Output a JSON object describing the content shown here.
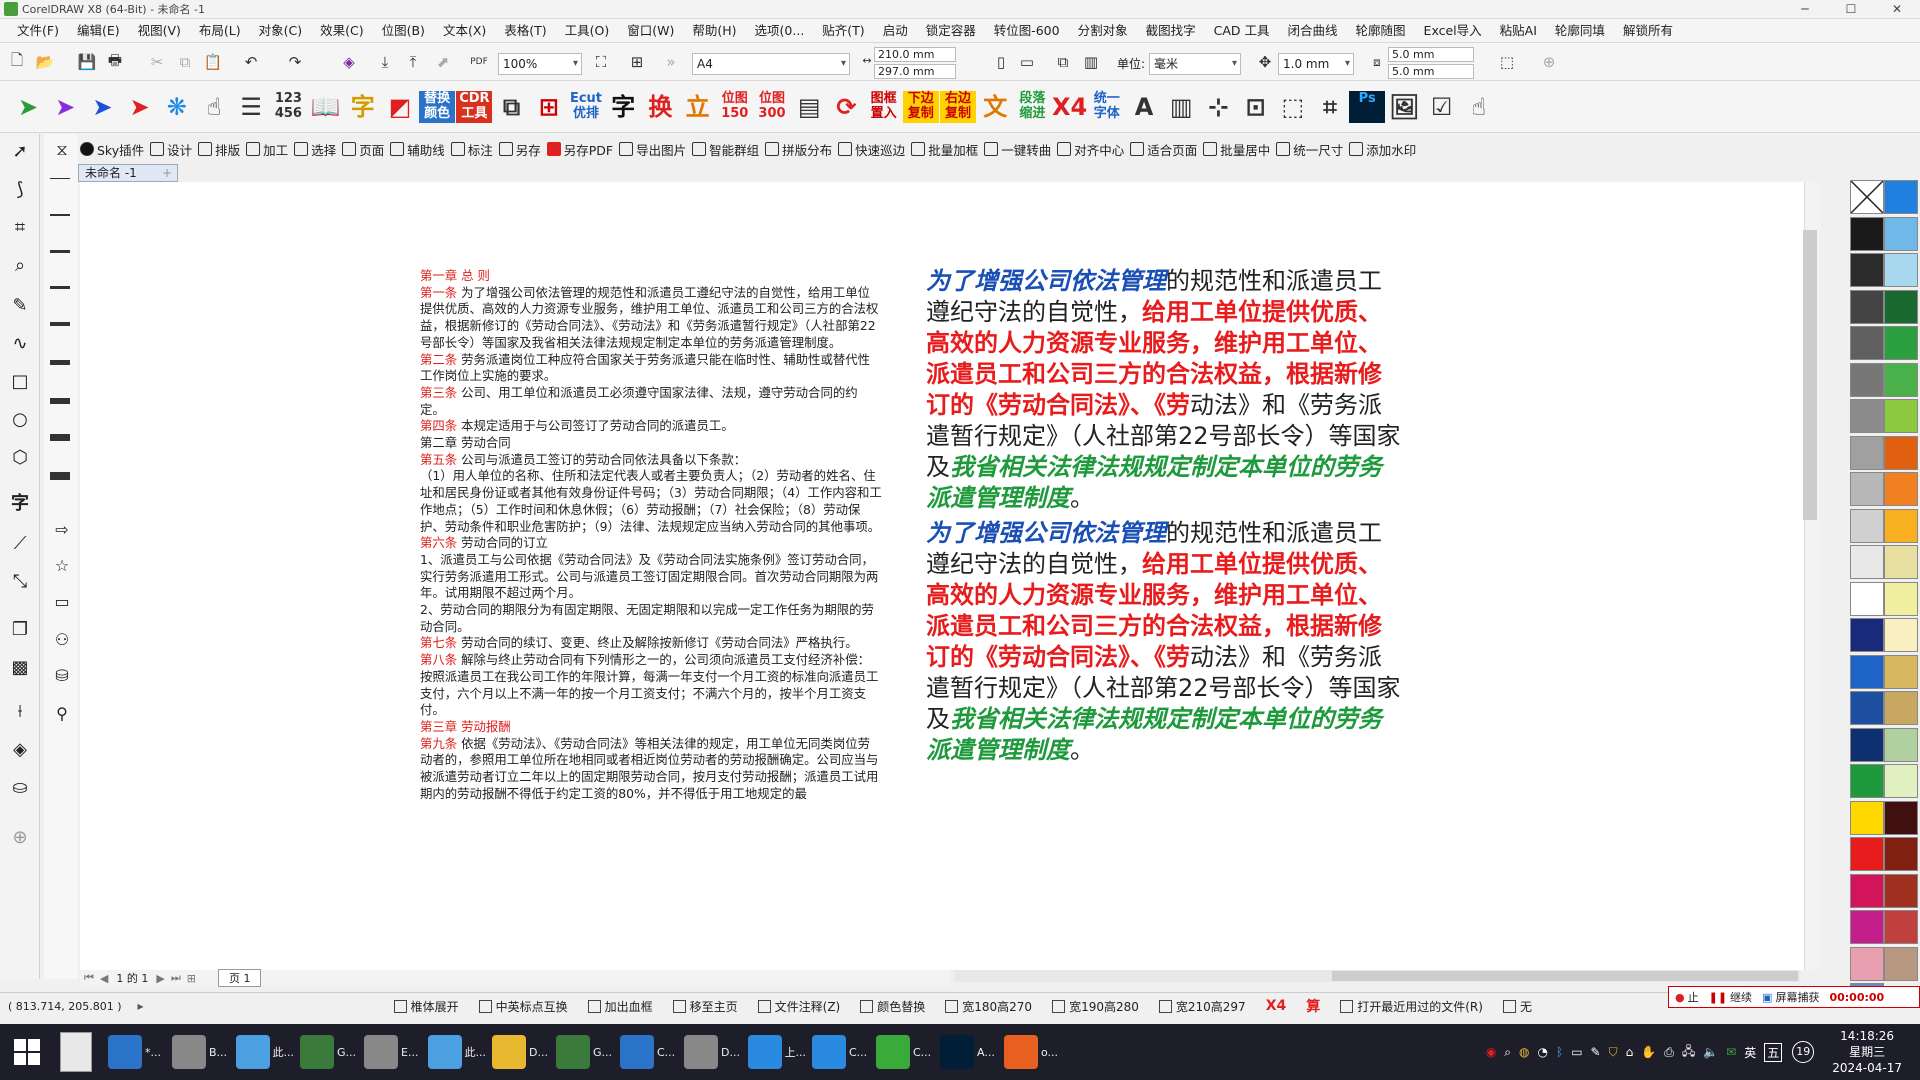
{
  "window": {
    "title": "CorelDRAW X8 (64-Bit) - 未命名 -1",
    "controls": [
      "─",
      "☐",
      "✕"
    ]
  },
  "menu": [
    "文件(F)",
    "编辑(E)",
    "视图(V)",
    "布局(L)",
    "对象(C)",
    "效果(C)",
    "位图(B)",
    "文本(X)",
    "表格(T)",
    "工具(O)",
    "窗口(W)",
    "帮助(H)",
    "选项(0...",
    "贴齐(T)",
    "启动",
    "锁定容器",
    "转位图-600",
    "分割对象",
    "截图找字",
    "CAD 工具",
    "闭合曲线",
    "轮廓随图",
    "Excel导入",
    "粘贴AI",
    "轮廓同填",
    "解锁所有"
  ],
  "std_toolbar": {
    "zoom": "100%",
    "paper": "A4",
    "width": "210.0 mm",
    "height": "297.0 mm",
    "units_label": "单位:",
    "units": "毫米",
    "nudge": "1.0 mm",
    "dup_x": "5.0 mm",
    "dup_y": "5.0 mm"
  },
  "big_icons": [
    {
      "kind": "glyph",
      "text": "➤",
      "color": "#2c9a3b"
    },
    {
      "kind": "glyph",
      "text": "➤",
      "color": "#8a2be2"
    },
    {
      "kind": "glyph",
      "text": "➤",
      "color": "#1e4fd8"
    },
    {
      "kind": "glyph",
      "text": "➤",
      "color": "#e02020"
    },
    {
      "kind": "glyph",
      "text": "❋",
      "color": "#1e88e5"
    },
    {
      "kind": "glyph",
      "text": "☝",
      "color": "#333"
    },
    {
      "kind": "glyph",
      "text": "☰",
      "color": "#333"
    },
    {
      "kind": "text",
      "text": "123 456",
      "color": "#333"
    },
    {
      "kind": "glyph",
      "text": "📖",
      "color": "#333"
    },
    {
      "kind": "glyph",
      "text": "字",
      "color": "#d49a00"
    },
    {
      "kind": "glyph",
      "text": "◩",
      "color": "#e02020"
    },
    {
      "kind": "text",
      "text": "替换 颜色",
      "color": "#fff",
      "bg": "#2a73c9"
    },
    {
      "kind": "text",
      "text": "CDR 工具",
      "color": "#fff",
      "bg": "#d8321e"
    },
    {
      "kind": "glyph",
      "text": "⧉",
      "color": "#333"
    },
    {
      "kind": "glyph",
      "text": "⊞",
      "color": "#c00"
    },
    {
      "kind": "text",
      "text": "Ecut 优排",
      "color": "#1e64c8"
    },
    {
      "kind": "glyph",
      "text": "字",
      "color": "#111"
    },
    {
      "kind": "glyph",
      "text": "换",
      "color": "#e02020"
    },
    {
      "kind": "glyph",
      "text": "立",
      "color": "#e07800"
    },
    {
      "kind": "text",
      "text": "位图 150",
      "color": "#e02020"
    },
    {
      "kind": "text",
      "text": "位图 300",
      "color": "#e02020"
    },
    {
      "kind": "glyph",
      "text": "▤",
      "color": "#333"
    },
    {
      "kind": "glyph",
      "text": "⟳",
      "color": "#e02020"
    },
    {
      "kind": "text",
      "text": "图框 置入",
      "color": "#c00"
    },
    {
      "kind": "text",
      "text": "下边 复制",
      "color": "#c00",
      "bg": "#ffd200"
    },
    {
      "kind": "text",
      "text": "右边 复制",
      "color": "#c00",
      "bg": "#ffd200"
    },
    {
      "kind": "glyph",
      "text": "文",
      "color": "#e07800"
    },
    {
      "kind": "text",
      "text": "段落 缩进",
      "color": "#1e9a3c"
    },
    {
      "kind": "glyph",
      "text": "X4",
      "color": "#e02020"
    },
    {
      "kind": "text",
      "text": "统一 字体",
      "color": "#1e64c8"
    },
    {
      "kind": "glyph",
      "text": "A",
      "color": "#333"
    },
    {
      "kind": "glyph",
      "text": "▥",
      "color": "#333"
    },
    {
      "kind": "glyph",
      "text": "⊹",
      "color": "#333"
    },
    {
      "kind": "glyph",
      "text": "⊡",
      "color": "#333"
    },
    {
      "kind": "glyph",
      "text": "⬚",
      "color": "#333"
    },
    {
      "kind": "glyph",
      "text": "⌗",
      "color": "#333"
    },
    {
      "kind": "text",
      "text": "Ps",
      "color": "#31a8ff",
      "bg": "#001e36"
    },
    {
      "kind": "glyph",
      "text": "🖼",
      "color": "#333"
    },
    {
      "kind": "glyph",
      "text": "☑",
      "color": "#333"
    },
    {
      "kind": "glyph",
      "text": "☝",
      "color": "#333"
    }
  ],
  "plugin_bar": [
    "Sky插件",
    "设计",
    "排版",
    "加工",
    "选择",
    "页面",
    "辅助线",
    "标注",
    "另存",
    "另存PDF",
    "导出图片",
    "智能群组",
    "拼版分布",
    "快速巡边",
    "批量加框",
    "一键转曲",
    "对齐中心",
    "适合页面",
    "批量居中",
    "统一尺寸",
    "添加水印"
  ],
  "doc_tab": "未命名 -1",
  "left_doc": [
    [
      {
        "t": "第一章  总 则",
        "r": true
      }
    ],
    [
      {
        "t": "第一条",
        "r": true
      },
      {
        "t": " 为了增强公司依法管理的规范性和派遣员工遵纪守法的自觉性，给用工单位提供优质、高效的人力资源专业服务，维护用工单位、派遣员工和公司三方的合法权益，根据新修订的《劳动合同法》、《劳动法》和《劳务派遣暂行规定》（人社部第22号部长令）等国家及我省相关法律法规规定制定本单位的劳务派遣管理制度。"
      }
    ],
    [
      {
        "t": "第二条",
        "r": true
      },
      {
        "t": " 劳务派遣岗位工种应符合国家关于劳务派遣只能在临时性、辅助性或替代性工作岗位上实施的要求。"
      }
    ],
    [
      {
        "t": "第三条",
        "r": true
      },
      {
        "t": " 公司、用工单位和派遣员工必须遵守国家法律、法规，遵守劳动合同的约定。"
      }
    ],
    [
      {
        "t": "第四条",
        "r": true
      },
      {
        "t": " 本规定适用于与公司签订了劳动合同的派遣员工。"
      }
    ],
    [
      {
        "t": "第二章 劳动合同"
      }
    ],
    [
      {
        "t": "第五条",
        "r": true
      },
      {
        "t": " 公司与派遣员工签订的劳动合同依法具备以下条款："
      }
    ],
    [
      {
        "t": "（1）用人单位的名称、住所和法定代表人或者主要负责人；（2）劳动者的姓名、住址和居民身份证或者其他有效身份证件号码；（3）劳动合同期限；（4）工作内容和工作地点；（5）工作时间和休息休假；（6）劳动报酬；（7）社会保险；（8）劳动保护、劳动条件和职业危害防护；（9）法律、法规规定应当纳入劳动合同的其他事项。"
      }
    ],
    [
      {
        "t": "第六条",
        "r": true
      },
      {
        "t": " 劳动合同的订立"
      }
    ],
    [
      {
        "t": "1、派遣员工与公司依据《劳动合同法》及《劳动合同法实施条例》签订劳动合同，实行劳务派遣用工形式。公司与派遣员工签订固定期限合同。首次劳动合同期限为两年。试用期限不超过两个月。"
      }
    ],
    [
      {
        "t": "2、劳动合同的期限分为有固定期限、无固定期限和以完成一定工作任务为期限的劳动合同。"
      }
    ],
    [
      {
        "t": "第七条",
        "r": true
      },
      {
        "t": " 劳动合同的续订、变更、终止及解除按新修订《劳动合同法》严格执行。"
      }
    ],
    [
      {
        "t": "第八条",
        "r": true
      },
      {
        "t": " 解除与终止劳动合同有下列情形之一的，公司须向派遣员工支付经济补偿：按照派遣员工在我公司工作的年限计算，每满一年支付一个月工资的标准向派遣员工支付，六个月以上不满一年的按一个月工资支付；不满六个月的，按半个月工资支付。"
      }
    ],
    [
      {
        "t": "第三章  劳动报酬",
        "r": true
      }
    ],
    [
      {
        "t": "第九条",
        "r": true
      },
      {
        "t": " 依据《劳动法》、《劳动合同法》等相关法律的规定，用工单位无同类岗位劳动者的，参照用工单位所在地相同或者相近岗位劳动者的劳动报酬确定。公司应当与被派遣劳动者订立二年以上的固定期限劳动合同，按月支付劳动报酬；派遣员工试用期内的劳动报酬不得低于约定工资的80%，并不得低于用工地规定的最"
      }
    ]
  ],
  "right_doc": [
    [
      {
        "t": "为了增强公司依法管理",
        "c": "b"
      },
      {
        "t": "的规范性和派遣员工遵纪守法的自觉性，",
        "c": "n"
      },
      {
        "t": "给用工单位提供优质、高效的人力资源专业服务，维护用工单位、派遣员工和公司三方的合法权益，根据新修订的《劳动合同法》、《劳",
        "c": "r"
      },
      {
        "t": "动法》和《劳务派遣暂行规定》（人社部第22号部长令）等国家及",
        "c": "n"
      },
      {
        "t": "我省相关法律法规规定制定本单位的劳务派遣管理制度",
        "c": "g"
      },
      {
        "t": "。",
        "c": "n"
      }
    ],
    [
      {
        "t": "为了增强公司依法管理",
        "c": "b"
      },
      {
        "t": "的规范性和派遣员工遵纪守法的自觉性，",
        "c": "n"
      },
      {
        "t": "给用工单位提供优质、高效的人力资源专业服务，维护用工单位、派遣员工和公司三方的合法权益，根据新修订的《劳动合同法》、《劳",
        "c": "r"
      },
      {
        "t": "动法》和《劳务派遣暂行规定》（人社部第22号部长令）等国家及",
        "c": "n"
      },
      {
        "t": "我省相关法律法规规定制定本单位的劳务派遣管理制度",
        "c": "g"
      },
      {
        "t": "。",
        "c": "n"
      }
    ]
  ],
  "page_nav": {
    "page_of": "1 的 1",
    "page_tab": "页 1"
  },
  "palette": [
    "#1a1a1a",
    "#2b2b2b",
    "#444",
    "#606060",
    "#777",
    "#8c8c8c",
    "#a0a0a0",
    "#b8b8b8",
    "#d0d0d0",
    "#e8e8e8",
    "#ffffff",
    "#1a2a7a",
    "#1e64c8",
    "#1d4fa0",
    "#0f3070",
    "#1e9a3c",
    "#ffd800",
    "#e81c1c",
    "#d4145a",
    "#c41e8c",
    "#e8a0b0",
    "#6a8ac8",
    "#2080e0",
    "#70b8e8",
    "#a8d8f0",
    "#1a6a30",
    "#2ca040",
    "#4ab04a",
    "#8cc840",
    "#e06010",
    "#f08020",
    "#f8b020",
    "#e8e0a0",
    "#f0f0a0",
    "#f8f0c0",
    "#d8b860",
    "#c8a860",
    "#b0d0a0",
    "#e0f0c0",
    "#401010",
    "#802010",
    "#a03020",
    "#c04040",
    "#b89880"
  ],
  "status": {
    "coords": "( 813.714, 205.801 )",
    "items": [
      "椎体展开",
      "中英标点互换",
      "加出血框",
      "移至主页",
      "文件注释(Z)",
      "颜色替换",
      "宽180高270",
      "宽190高280",
      "宽210高297",
      "X4",
      "算",
      "打开最近用过的文件(R)",
      "无"
    ],
    "rec_stop": "止",
    "rec_continue": "继续",
    "rec_capture": "屏幕捕获",
    "rec_time": "00:00:00"
  },
  "taskbar": {
    "apps": [
      {
        "name": "*...",
        "color": "#2a73c9"
      },
      {
        "name": "B...",
        "color": "#888"
      },
      {
        "name": "此...",
        "color": "#4aa0e0"
      },
      {
        "name": "G...",
        "color": "#3a7a3a"
      },
      {
        "name": "E...",
        "color": "#888"
      },
      {
        "name": "此...",
        "color": "#4aa0e0"
      },
      {
        "name": "D...",
        "color": "#e8b830"
      },
      {
        "name": "G...",
        "color": "#3a7a3a"
      },
      {
        "name": "C...",
        "color": "#2a73c9"
      },
      {
        "name": "D...",
        "color": "#888"
      },
      {
        "name": "上...",
        "color": "#2a8ae0"
      },
      {
        "name": "C...",
        "color": "#2a8ae0"
      },
      {
        "name": "C...",
        "color": "#3aaa3a"
      },
      {
        "name": "A...",
        "color": "#001e36"
      },
      {
        "name": "o...",
        "color": "#e86020"
      }
    ],
    "lang": "英",
    "ime": "五",
    "day_badge": "19",
    "time": "14:18:26",
    "weekday": "星期三",
    "date": "2024-04-17"
  }
}
